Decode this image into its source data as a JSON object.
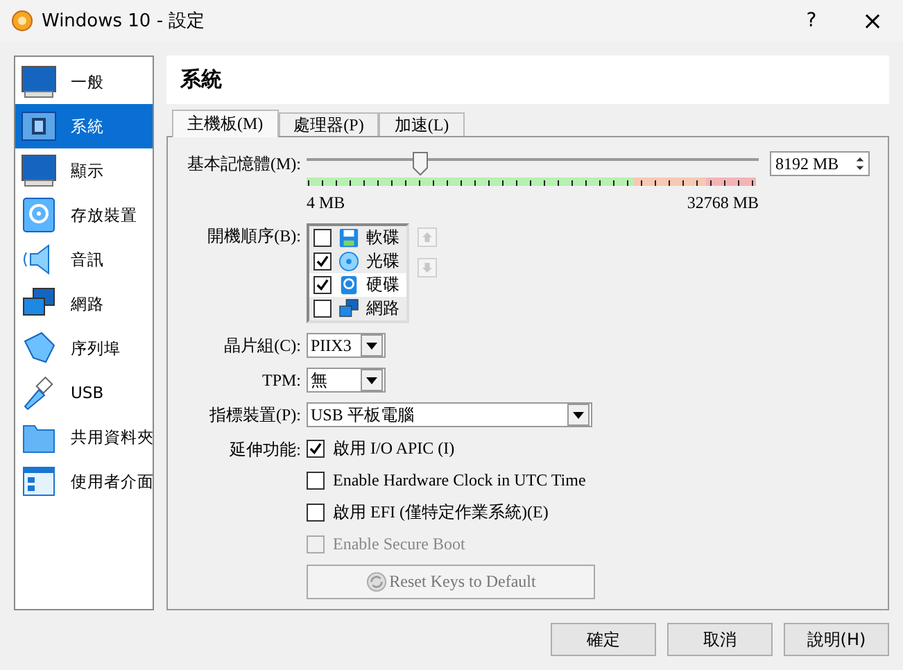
{
  "window": {
    "title": "Windows 10 - 設定",
    "help": "?",
    "close": "×"
  },
  "sidebar": {
    "items": [
      {
        "label": "一般",
        "selected": false
      },
      {
        "label": "系統",
        "selected": true
      },
      {
        "label": "顯示",
        "selected": false
      },
      {
        "label": "存放裝置",
        "selected": false
      },
      {
        "label": "音訊",
        "selected": false
      },
      {
        "label": "網路",
        "selected": false
      },
      {
        "label": "序列埠",
        "selected": false
      },
      {
        "label": "USB",
        "selected": false
      },
      {
        "label": "共用資料夾",
        "selected": false
      },
      {
        "label": "使用者介面",
        "selected": false
      }
    ]
  },
  "page_title": "系統",
  "tabs": [
    {
      "label": "主機板(M)",
      "selected": true
    },
    {
      "label": "處理器(P)",
      "selected": false
    },
    {
      "label": "加速(L)",
      "selected": false
    }
  ],
  "memory": {
    "label": "基本記憶體(M):",
    "level": 0.25,
    "value": "8192 MB",
    "min_label": "4 MB",
    "max_label": "32768 MB"
  },
  "boot_order": {
    "label": "開機順序(B):",
    "items": [
      {
        "label": "軟碟",
        "checked": false
      },
      {
        "label": "光碟",
        "checked": true
      },
      {
        "label": "硬碟",
        "checked": true
      },
      {
        "label": "網路",
        "checked": false
      }
    ]
  },
  "chipset": {
    "label": "晶片組(C):",
    "value": "PIIX3"
  },
  "tpm": {
    "label": "TPM:",
    "value": "無"
  },
  "pointing_device": {
    "label": "指標裝置(P):",
    "value": "USB 平板電腦"
  },
  "extended_features": {
    "label": "延伸功能:",
    "options": [
      {
        "label": "啟用 I/O APIC (I)",
        "checked": true,
        "disabled": false
      },
      {
        "label": "Enable Hardware Clock in UTC Time",
        "checked": false,
        "disabled": false
      },
      {
        "label": "啟用 EFI (僅特定作業系統)(E)",
        "checked": false,
        "disabled": false
      },
      {
        "label": "Enable Secure Boot",
        "checked": false,
        "disabled": true
      }
    ]
  },
  "reset_keys_button": {
    "label": "Reset Keys to Default",
    "disabled": true
  },
  "buttons": [
    {
      "label": "確定"
    },
    {
      "label": "取消"
    },
    {
      "label": "說明(H)"
    }
  ]
}
